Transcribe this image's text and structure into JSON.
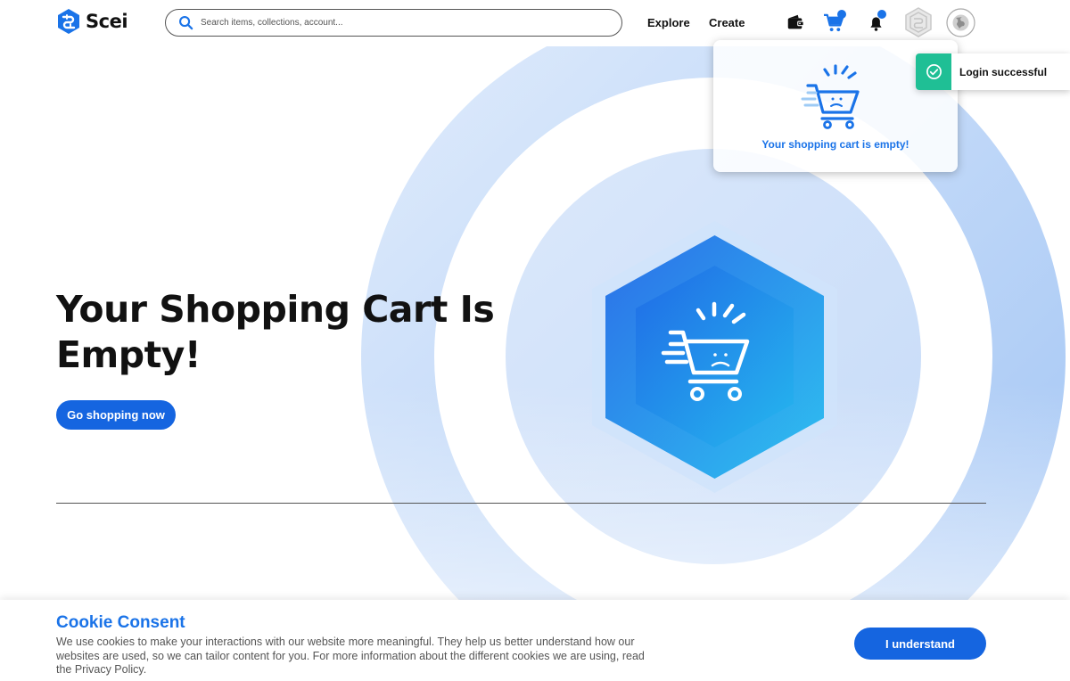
{
  "brand": {
    "name": "Scei"
  },
  "search": {
    "placeholder": "Search items, collections, account..."
  },
  "nav": {
    "explore": "Explore",
    "create": "Create"
  },
  "header_icons": [
    "wallet-icon",
    "cart-icon",
    "bell-icon",
    "profile-hex-icon",
    "globe-icon"
  ],
  "cart_popup": {
    "message": "Your shopping cart is empty!"
  },
  "toast": {
    "message": "Login successful"
  },
  "hero": {
    "title_line1": "Your Shopping Cart Is",
    "title_line2": "Empty!",
    "button_label": "Go shopping now"
  },
  "cookie": {
    "title": "Cookie Consent",
    "text": "We use cookies to make your interactions with our website more meaningful. They help us better understand how our websites are used, so we can tailor content for you. For more information about the different cookies we are using, read the Privacy Policy.",
    "button_label": "I understand"
  },
  "colors": {
    "accent": "#1565e0",
    "brand_blue": "#1a73e8",
    "success": "#1fbf95",
    "ring_light": "#d6e6fb",
    "ring_outer": "#a9c9f5"
  }
}
